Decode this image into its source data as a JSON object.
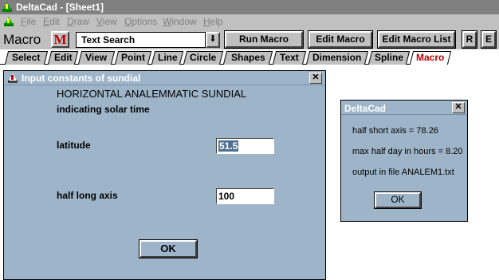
{
  "app": {
    "title": "DeltaCad - [Sheet1]"
  },
  "menu": [
    "File",
    "Edit",
    "Draw",
    "View",
    "Options",
    "Window",
    "Help"
  ],
  "toolbar": {
    "macro_label": "Macro",
    "m_button": "M",
    "search_value": "Text Search",
    "dropdown_glyph": "⬇",
    "run_macro": "Run Macro",
    "edit_macro": "Edit Macro",
    "edit_macro_list": "Edit Macro List",
    "r_button": "R",
    "e_button": "E"
  },
  "tabs": [
    "Select",
    "Edit",
    "View",
    "Point",
    "Line",
    "Circle",
    "Shapes",
    "Text",
    "Dimension",
    "Spline",
    "Macro"
  ],
  "active_tab": "Macro",
  "dialog_main": {
    "title": "Input constants of sundial",
    "close": "✕",
    "heading1": "HORIZONTAL ANALEMMATIC SUNDIAL",
    "heading2": "indicating solar time",
    "latitude_label": "latitude",
    "latitude_value": "51.5",
    "axis_label": "half long axis",
    "axis_value": "100",
    "ok": "OK"
  },
  "dialog_msg": {
    "title": "DeltaCad",
    "close": "✕",
    "line1": "half short axis = 78.26",
    "line2": "max half day in hours = 8.20",
    "line3": "output in file ANALEM1.txt",
    "ok": "OK"
  },
  "colors": {
    "dialog_bg": "#9eb5c9",
    "chrome": "#c0c0c0",
    "active_tab_text": "#c00000"
  }
}
